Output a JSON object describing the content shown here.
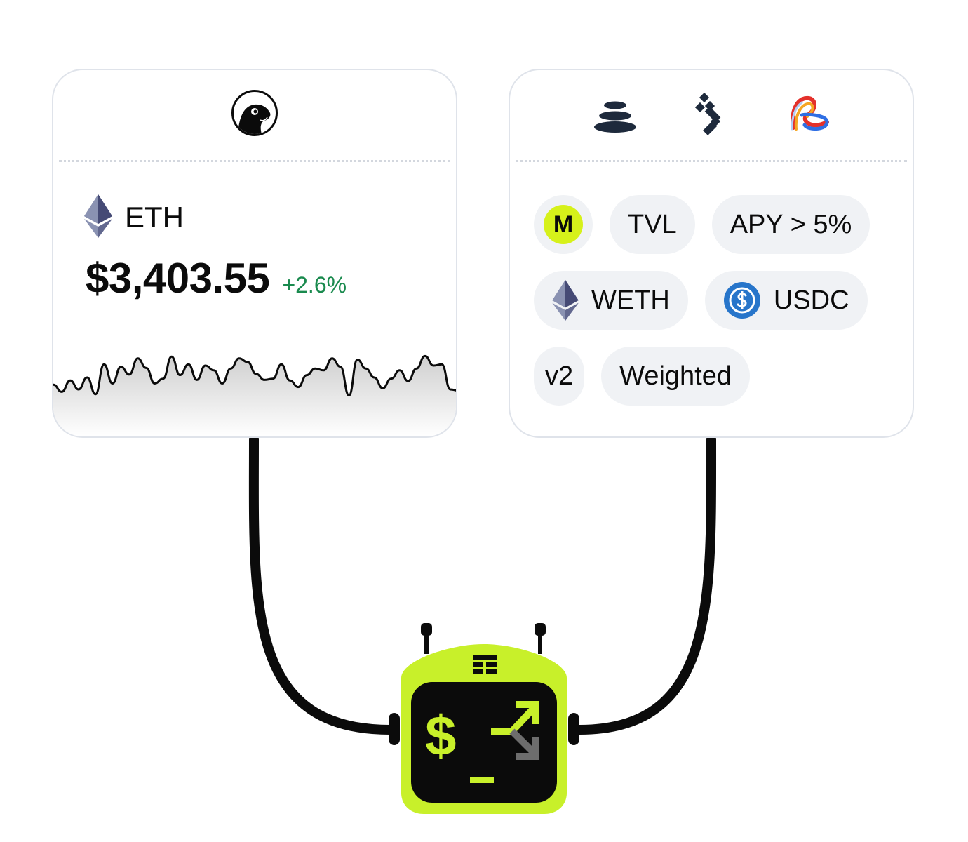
{
  "price_card": {
    "provider_icon": "coingecko-gecko-icon",
    "token": {
      "icon": "ethereum-icon",
      "symbol": "ETH"
    },
    "price": "$3,403.55",
    "change": "+2.6%",
    "colors": {
      "change_positive": "#1a8a4e"
    },
    "sparkline": [
      0.28,
      0.16,
      0.35,
      0.2,
      0.4,
      0.12,
      0.62,
      0.3,
      0.58,
      0.45,
      0.72,
      0.56,
      0.3,
      0.38,
      0.75,
      0.44,
      0.62,
      0.36,
      0.6,
      0.52,
      0.3,
      0.55,
      0.72,
      0.66,
      0.46,
      0.36,
      0.38,
      0.62,
      0.35,
      0.24,
      0.44,
      0.55,
      0.52,
      0.72,
      0.58,
      0.1,
      0.7,
      0.55,
      0.4,
      0.22,
      0.38,
      0.52,
      0.34,
      0.55,
      0.76,
      0.6,
      0.62,
      0.2,
      0.18
    ]
  },
  "pool_card": {
    "protocol_icons": [
      "balancer-icon",
      "curve-stack-icon",
      "multicolor-ribbon-icon"
    ],
    "chips": [
      [
        {
          "icon": "m-badge-icon",
          "badge_text": "M"
        },
        {
          "label": "TVL"
        },
        {
          "label": "APY > 5%"
        }
      ],
      [
        {
          "icon": "ethereum-icon",
          "label": "WETH"
        },
        {
          "icon": "usdc-icon",
          "label": "USDC"
        }
      ],
      [
        {
          "label": "v2"
        },
        {
          "label": "Weighted"
        }
      ]
    ],
    "colors": {
      "chip_bg": "#f0f2f5",
      "m_badge": "#d6f11a",
      "usdc": "#2775ca"
    }
  },
  "robot": {
    "icon": "terminal-robot-icon",
    "screen_dollar": "$",
    "colors": {
      "body": "#c8f02a",
      "screen": "#0d0d0d",
      "accent": "#c8f02a"
    }
  }
}
